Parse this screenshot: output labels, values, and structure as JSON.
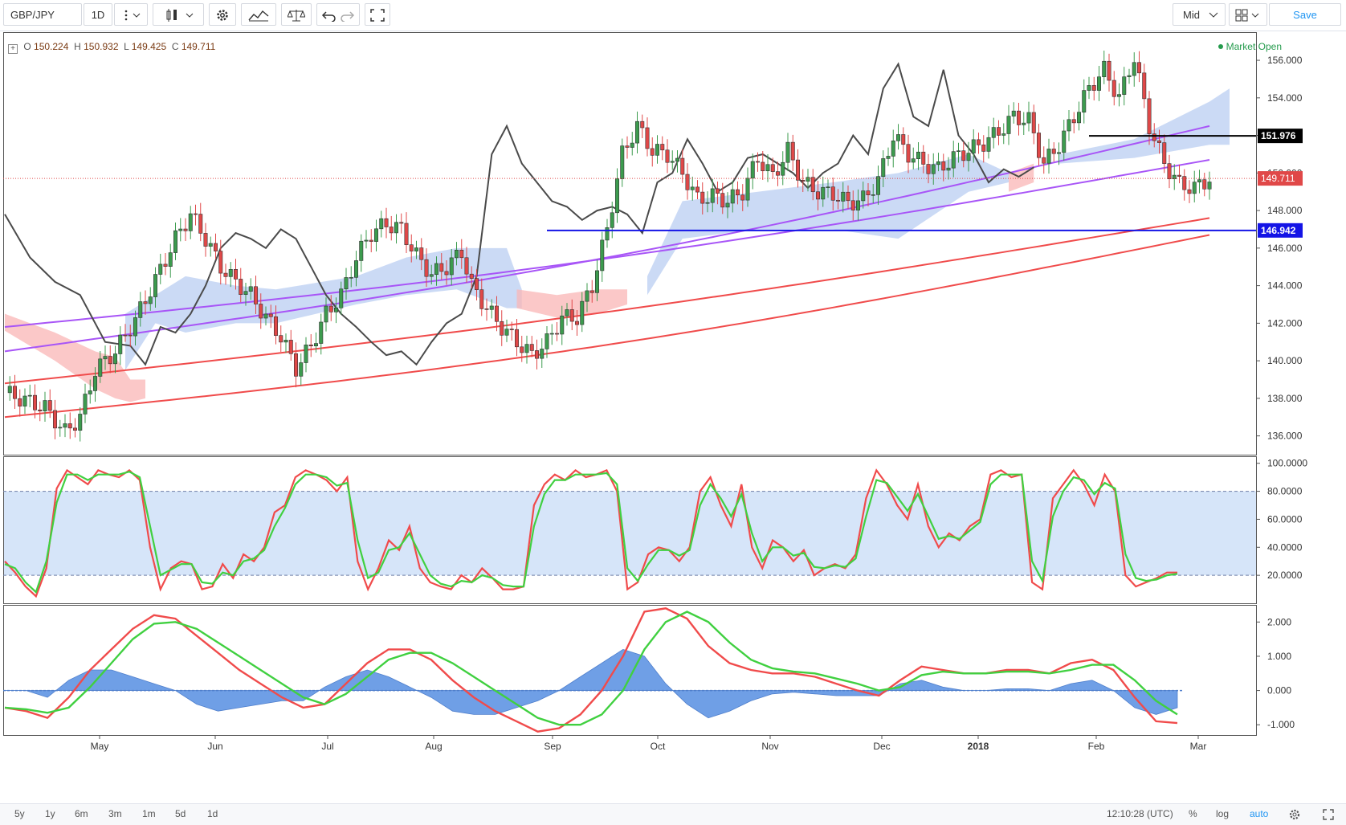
{
  "toolbar": {
    "symbol": "GBP/JPY",
    "interval": "1D",
    "price_type": "Mid",
    "save_label": "Save"
  },
  "legend": {
    "o_label": "O",
    "o": "150.224",
    "h_label": "H",
    "h": "150.932",
    "l_label": "L",
    "l": "149.425",
    "c_label": "C",
    "c": "149.711",
    "market_status": "Market Open"
  },
  "colors": {
    "up": "#3c9b4e",
    "down": "#e04848",
    "ma_red": "#f04b4b",
    "ma_purple": "#a855f7",
    "cloud_blue": "#b9cdf2",
    "cloud_red": "#f9b6b6",
    "overlay_line": "#4a4a4a",
    "hline_blue": "#1414e6",
    "hline_black": "#000000",
    "stoch_k": "#f04b4b",
    "stoch_d": "#40d040",
    "macd_hist": "#6f9fe6"
  },
  "chart_data": [
    {
      "type": "candlestick",
      "panel": "price",
      "ylim": [
        135.0,
        157.5
      ],
      "y_ticks": [
        "136.000",
        "138.000",
        "140.000",
        "142.000",
        "144.000",
        "146.000",
        "148.000",
        "150.000",
        "152.000",
        "154.000",
        "156.000"
      ],
      "x_ticks": [
        "May",
        "Jun",
        "Jul",
        "Aug",
        "Sep",
        "Oct",
        "Nov",
        "Dec",
        "2018",
        "Feb",
        "Mar"
      ],
      "price_path": [
        [
          0,
          138.3
        ],
        [
          8,
          137.5
        ],
        [
          12,
          136.2
        ],
        [
          15,
          137.0
        ],
        [
          18,
          139.5
        ],
        [
          22,
          140.5
        ],
        [
          26,
          142.2
        ],
        [
          30,
          144.3
        ],
        [
          34,
          146.5
        ],
        [
          37,
          147.8
        ],
        [
          40,
          146.5
        ],
        [
          43,
          145.0
        ],
        [
          46,
          144.2
        ],
        [
          49,
          143.5
        ],
        [
          52,
          142.3
        ],
        [
          55,
          141.3
        ],
        [
          58,
          139.6
        ],
        [
          61,
          140.8
        ],
        [
          64,
          142.5
        ],
        [
          67,
          143.5
        ],
        [
          70,
          145.5
        ],
        [
          73,
          146.8
        ],
        [
          76,
          147.3
        ],
        [
          79,
          147.0
        ],
        [
          82,
          145.6
        ],
        [
          85,
          144.6
        ],
        [
          88,
          145.0
        ],
        [
          91,
          145.8
        ],
        [
          93,
          144.0
        ],
        [
          96,
          142.8
        ],
        [
          99,
          141.8
        ],
        [
          102,
          141.0
        ],
        [
          105,
          140.3
        ],
        [
          108,
          141.0
        ],
        [
          111,
          142.3
        ],
        [
          114,
          142.3
        ],
        [
          117,
          144.0
        ],
        [
          120,
          147.0
        ],
        [
          123,
          151.0
        ],
        [
          126,
          152.5
        ],
        [
          129,
          151.2
        ],
        [
          132,
          151.0
        ],
        [
          135,
          150.0
        ],
        [
          138,
          148.6
        ],
        [
          141,
          148.8
        ],
        [
          144,
          148.5
        ],
        [
          147,
          149.0
        ],
        [
          150,
          150.8
        ],
        [
          153,
          149.8
        ],
        [
          156,
          151.2
        ],
        [
          159,
          149.5
        ],
        [
          162,
          149.0
        ],
        [
          165,
          148.9
        ],
        [
          168,
          148.4
        ],
        [
          171,
          148.6
        ],
        [
          174,
          149.6
        ],
        [
          177,
          152.0
        ],
        [
          180,
          151.0
        ],
        [
          183,
          150.5
        ],
        [
          186,
          150.2
        ],
        [
          189,
          150.8
        ],
        [
          192,
          151.2
        ],
        [
          195,
          151.6
        ],
        [
          198,
          152.2
        ],
        [
          201,
          153.0
        ],
        [
          204,
          152.8
        ],
        [
          207,
          150.5
        ],
        [
          210,
          151.5
        ],
        [
          213,
          153.0
        ],
        [
          216,
          154.5
        ],
        [
          219,
          155.5
        ],
        [
          222,
          154.0
        ],
        [
          225,
          156.2
        ],
        [
          228,
          152.5
        ],
        [
          231,
          150.5
        ],
        [
          234,
          149.4
        ],
        [
          237,
          149.2
        ],
        [
          240,
          149.7
        ]
      ],
      "ma_red_fast": {
        "start": [
          0,
          138.8
        ],
        "end": [
          240,
          147.6
        ]
      },
      "ma_red_slow": {
        "start": [
          0,
          137.0
        ],
        "end": [
          240,
          146.7
        ]
      },
      "ma_purple_fast": {
        "start": [
          0,
          140.5
        ],
        "end": [
          240,
          152.5
        ]
      },
      "ma_purple_slow": {
        "start": [
          0,
          141.8
        ],
        "end": [
          240,
          150.7
        ]
      },
      "overlay_path": [
        [
          0,
          147.8
        ],
        [
          5,
          145.5
        ],
        [
          10,
          144.2
        ],
        [
          15,
          143.5
        ],
        [
          20,
          141.0
        ],
        [
          25,
          140.8
        ],
        [
          28,
          139.8
        ],
        [
          31,
          141.8
        ],
        [
          34,
          141.5
        ],
        [
          37,
          142.5
        ],
        [
          40,
          144.0
        ],
        [
          43,
          146.0
        ],
        [
          46,
          146.8
        ],
        [
          49,
          146.5
        ],
        [
          52,
          146.0
        ],
        [
          55,
          147.0
        ],
        [
          58,
          146.5
        ],
        [
          61,
          145.0
        ],
        [
          64,
          143.5
        ],
        [
          67,
          142.5
        ],
        [
          70,
          141.8
        ],
        [
          73,
          141.0
        ],
        [
          76,
          140.3
        ],
        [
          79,
          140.5
        ],
        [
          82,
          139.8
        ],
        [
          85,
          141.0
        ],
        [
          88,
          142.0
        ],
        [
          91,
          142.5
        ],
        [
          94,
          144.5
        ],
        [
          97,
          151.0
        ],
        [
          100,
          152.5
        ],
        [
          103,
          150.5
        ],
        [
          106,
          149.5
        ],
        [
          109,
          148.5
        ],
        [
          112,
          148.2
        ],
        [
          115,
          147.5
        ],
        [
          118,
          148.0
        ],
        [
          121,
          148.2
        ],
        [
          124,
          147.8
        ],
        [
          127,
          146.8
        ],
        [
          130,
          149.5
        ],
        [
          133,
          150.0
        ],
        [
          136,
          151.8
        ],
        [
          139,
          150.5
        ],
        [
          142,
          149.0
        ],
        [
          145,
          149.5
        ],
        [
          148,
          150.8
        ],
        [
          151,
          151.0
        ],
        [
          154,
          150.5
        ],
        [
          157,
          150.0
        ],
        [
          160,
          149.2
        ],
        [
          163,
          150.0
        ],
        [
          166,
          150.5
        ],
        [
          169,
          152.0
        ],
        [
          172,
          151.0
        ],
        [
          175,
          154.5
        ],
        [
          178,
          155.8
        ],
        [
          181,
          153.0
        ],
        [
          184,
          152.5
        ],
        [
          187,
          155.5
        ],
        [
          190,
          152.0
        ],
        [
          193,
          151.0
        ],
        [
          196,
          149.5
        ],
        [
          199,
          150.2
        ],
        [
          202,
          149.8
        ],
        [
          205,
          150.3
        ]
      ],
      "hlines": [
        {
          "value": 151.976,
          "label": "151.976",
          "color": "#000000"
        },
        {
          "value": 146.942,
          "label": "146.942",
          "color": "#1414e6"
        }
      ],
      "last_price": {
        "value": 149.711,
        "label": "149.711"
      }
    },
    {
      "type": "line",
      "panel": "stochastic",
      "ylim": [
        0,
        105
      ],
      "y_ticks": [
        "20.0000",
        "40.0000",
        "60.0000",
        "80.0000",
        "100.0000"
      ],
      "band": [
        20,
        80
      ],
      "series": [
        {
          "values": [
            30,
            22,
            12,
            5,
            25,
            82,
            95,
            90,
            85,
            95,
            92,
            90,
            95,
            88,
            40,
            10,
            25,
            30,
            28,
            10,
            12,
            28,
            18,
            35,
            30,
            40,
            65,
            70,
            90,
            95,
            92,
            88,
            80,
            90,
            30,
            10,
            25,
            45,
            38,
            55,
            25,
            15,
            12,
            10,
            20,
            15,
            25,
            18,
            10,
            10,
            12,
            70,
            85,
            92,
            88,
            95,
            90,
            92,
            95,
            80,
            10,
            15,
            35,
            40,
            38,
            30,
            40,
            80,
            90,
            70,
            55,
            85,
            40,
            25,
            45,
            40,
            30,
            38,
            20,
            25,
            28,
            25,
            35,
            75,
            95,
            85,
            70,
            60,
            85,
            55,
            40,
            50,
            45,
            55,
            60,
            92,
            95,
            90,
            92,
            15,
            10,
            75,
            85,
            95,
            85,
            70,
            92,
            80,
            20,
            12,
            15,
            18,
            22,
            22
          ]
        },
        {
          "values": [
            28,
            25,
            15,
            8,
            30,
            72,
            92,
            92,
            88,
            92,
            92,
            92,
            94,
            90,
            55,
            20,
            24,
            28,
            28,
            15,
            14,
            22,
            20,
            30,
            32,
            38,
            55,
            68,
            85,
            92,
            92,
            90,
            84,
            86,
            45,
            18,
            22,
            38,
            40,
            50,
            35,
            20,
            14,
            12,
            16,
            15,
            20,
            18,
            13,
            12,
            12,
            55,
            78,
            88,
            88,
            92,
            92,
            92,
            93,
            85,
            25,
            16,
            28,
            38,
            38,
            34,
            38,
            70,
            85,
            75,
            62,
            78,
            50,
            30,
            40,
            40,
            34,
            36,
            26,
            25,
            27,
            26,
            32,
            62,
            88,
            86,
            76,
            66,
            78,
            62,
            46,
            48,
            46,
            52,
            58,
            85,
            92,
            92,
            92,
            30,
            16,
            62,
            80,
            90,
            88,
            78,
            86,
            82,
            35,
            18,
            16,
            17,
            20,
            21
          ]
        }
      ]
    },
    {
      "type": "area",
      "panel": "macd",
      "ylim": [
        -1.3,
        2.5
      ],
      "y_ticks": [
        "-1.000",
        "0.000",
        "1.000",
        "2.000"
      ],
      "series": [
        {
          "values": [
            -0.5,
            -0.6,
            -0.8,
            -0.2,
            0.6,
            1.2,
            1.8,
            2.2,
            2.1,
            1.6,
            1.1,
            0.6,
            0.2,
            -0.2,
            -0.5,
            -0.4,
            0.2,
            0.8,
            1.2,
            1.2,
            0.9,
            0.3,
            -0.2,
            -0.6,
            -0.9,
            -1.2,
            -1.1,
            -0.7,
            0.0,
            1.0,
            2.3,
            2.4,
            2.1,
            1.3,
            0.8,
            0.6,
            0.5,
            0.5,
            0.4,
            0.2,
            0.0,
            -0.15,
            0.3,
            0.7,
            0.6,
            0.5,
            0.5,
            0.6,
            0.6,
            0.5,
            0.8,
            0.9,
            0.6,
            -0.2,
            -0.9,
            -0.95
          ]
        },
        {
          "values": [
            -0.5,
            -0.55,
            -0.65,
            -0.5,
            0.1,
            0.8,
            1.5,
            1.95,
            2.0,
            1.8,
            1.4,
            1.0,
            0.6,
            0.2,
            -0.2,
            -0.4,
            -0.1,
            0.4,
            0.9,
            1.1,
            1.1,
            0.8,
            0.4,
            0.0,
            -0.4,
            -0.8,
            -1.0,
            -1.0,
            -0.7,
            0.0,
            1.2,
            2.0,
            2.3,
            2.0,
            1.4,
            0.9,
            0.65,
            0.55,
            0.5,
            0.35,
            0.2,
            0.0,
            0.1,
            0.45,
            0.55,
            0.5,
            0.5,
            0.55,
            0.55,
            0.5,
            0.6,
            0.75,
            0.75,
            0.3,
            -0.3,
            -0.7
          ]
        },
        {
          "values": [
            0,
            0,
            -0.2,
            0.3,
            0.6,
            0.6,
            0.4,
            0.2,
            0.0,
            -0.4,
            -0.6,
            -0.5,
            -0.4,
            -0.3,
            -0.3,
            0.1,
            0.4,
            0.6,
            0.4,
            0.1,
            -0.2,
            -0.6,
            -0.7,
            -0.7,
            -0.5,
            -0.3,
            0.0,
            0.4,
            0.8,
            1.2,
            1.0,
            0.2,
            -0.4,
            -0.8,
            -0.6,
            -0.3,
            -0.1,
            -0.05,
            -0.1,
            -0.15,
            -0.15,
            -0.15,
            0.2,
            0.3,
            0.1,
            0.0,
            0.0,
            0.05,
            0.05,
            0.0,
            0.2,
            0.3,
            0.0,
            -0.5,
            -0.7,
            -0.5
          ]
        }
      ]
    }
  ],
  "bottom": {
    "ranges": [
      "5y",
      "1y",
      "6m",
      "3m",
      "1m",
      "5d",
      "1d"
    ],
    "time": "12:10:28 (UTC)",
    "pct": "%",
    "log": "log",
    "auto": "auto"
  }
}
